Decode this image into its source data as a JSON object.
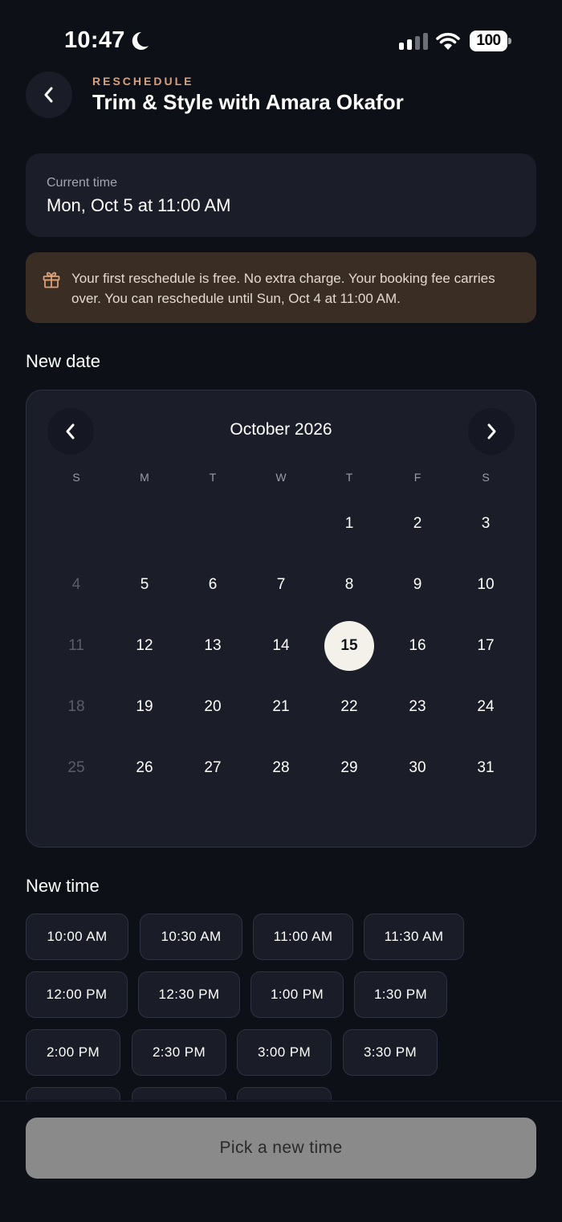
{
  "status_bar": {
    "time": "10:47",
    "focus_icon": "moon-icon",
    "signal_icon": "cellular-signal-icon",
    "wifi_icon": "wifi-icon",
    "battery_level": "100"
  },
  "header": {
    "back_icon": "chevron-left-icon",
    "eyebrow": "RESCHEDULE",
    "title": "Trim & Style with Amara Okafor"
  },
  "current_time": {
    "label": "Current time",
    "value": "Mon, Oct 5 at 11:00 AM"
  },
  "notice": {
    "icon": "gift-icon",
    "text": "Your first reschedule is free. No extra charge. Your booking fee carries over. You can reschedule until Sun, Oct 4 at 11:00 AM."
  },
  "new_date": {
    "title": "New date",
    "calendar": {
      "month_label": "October 2026",
      "prev_icon": "chevron-left-icon",
      "next_icon": "chevron-right-icon",
      "weekdays": [
        "S",
        "M",
        "T",
        "W",
        "T",
        "F",
        "S"
      ],
      "weeks": [
        [
          null,
          null,
          null,
          null,
          "1",
          "2",
          "3"
        ],
        [
          "4",
          "5",
          "6",
          "7",
          "8",
          "9",
          "10"
        ],
        [
          "11",
          "12",
          "13",
          "14",
          "15",
          "16",
          "17"
        ],
        [
          "18",
          "19",
          "20",
          "21",
          "22",
          "23",
          "24"
        ],
        [
          "25",
          "26",
          "27",
          "28",
          "29",
          "30",
          "31"
        ]
      ],
      "disabled_days": [
        "4",
        "11",
        "18",
        "25"
      ],
      "selected_day": "15"
    }
  },
  "new_time": {
    "title": "New time",
    "rows": [
      [
        "10:00 AM",
        "10:30 AM",
        "11:00 AM",
        "11:30 AM"
      ],
      [
        "12:00 PM",
        "12:30 PM",
        "1:00 PM",
        "1:30 PM"
      ],
      [
        "2:00 PM",
        "2:30 PM",
        "3:00 PM",
        "3:30 PM"
      ],
      [
        "",
        "",
        ""
      ]
    ]
  },
  "footer": {
    "cta_label": "Pick a new time"
  },
  "colors": {
    "background": "#0e1018",
    "card": "#1b1e29",
    "accent": "#d9a07a",
    "notice_bg": "#3a2e24",
    "selected_day_bg": "#f4f1ea",
    "cta_disabled": "#8a8a8a"
  }
}
